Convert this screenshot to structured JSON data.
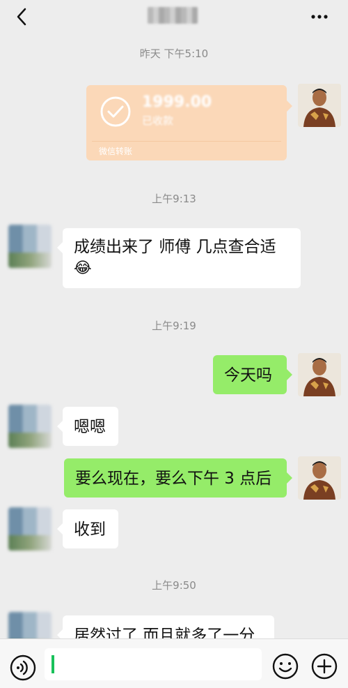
{
  "header": {
    "title": "",
    "back_icon": "chevron-left-icon",
    "more_icon": "more-dots-icon"
  },
  "timestamps": [
    "昨天 下午5:10",
    "上午9:13",
    "上午9:19",
    "上午9:50"
  ],
  "transfer": {
    "amount": "1999.00",
    "status": "已收款",
    "label": "微信转账"
  },
  "messages": [
    {
      "side": "left",
      "text": "成绩出来了 师傅 几点查合适",
      "emoji": "😂"
    },
    {
      "side": "right",
      "text": "今天吗"
    },
    {
      "side": "left",
      "text": "嗯嗯"
    },
    {
      "side": "right",
      "text": "要么现在，要么下午 3 点后"
    },
    {
      "side": "left",
      "text": "收到"
    },
    {
      "side": "left",
      "text": "居然过了 而且就多了一分"
    }
  ],
  "bottom": {
    "voice_icon": "voice-icon",
    "emoji_icon": "emoji-icon",
    "plus_icon": "plus-icon",
    "input_value": ""
  },
  "colors": {
    "background": "#ededed",
    "bubble_left": "#ffffff",
    "bubble_right": "#95ec69",
    "transfer": "#fbd8b8",
    "timestamp": "#8a8a8a"
  }
}
